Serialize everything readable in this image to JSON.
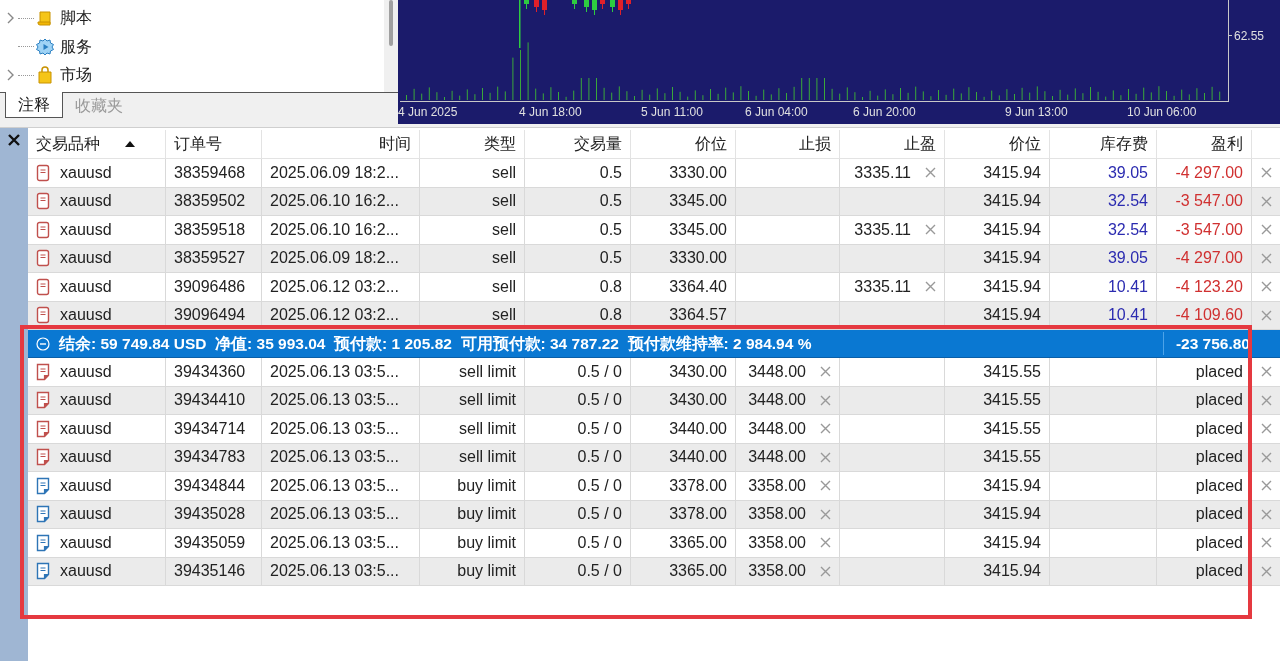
{
  "navigator": {
    "items": [
      {
        "label": "脚本",
        "kind": "script",
        "expandable": true
      },
      {
        "label": "服务",
        "kind": "service",
        "expandable": false
      },
      {
        "label": "市场",
        "kind": "market",
        "expandable": true
      }
    ]
  },
  "navigator_tabs": [
    {
      "label": "注释",
      "selected": true
    },
    {
      "label": "收藏夹",
      "selected": false
    }
  ],
  "chart": {
    "price_label": "62.55",
    "time_labels": [
      "4 Jun 2025",
      "4 Jun 18:00",
      "5 Jun 11:00",
      "6 Jun 04:00",
      "6 Jun 20:00",
      "9 Jun 13:00",
      "10 Jun 06:00"
    ]
  },
  "table": {
    "columns": [
      {
        "label": "交易品种",
        "sorted": true
      },
      {
        "label": "订单号",
        "sorted": false
      },
      {
        "label": "时间",
        "sorted": false
      },
      {
        "label": "类型",
        "sorted": false
      },
      {
        "label": "交易量",
        "sorted": false
      },
      {
        "label": "价位",
        "sorted": false
      },
      {
        "label": "止损",
        "sorted": false
      },
      {
        "label": "止盈",
        "sorted": false
      },
      {
        "label": "价位",
        "sorted": false
      },
      {
        "label": "库存费",
        "sorted": false
      },
      {
        "label": "盈利",
        "sorted": false
      }
    ],
    "positions": [
      {
        "kind": "position",
        "color": "#c0504d",
        "symbol": "xauusd",
        "order": "38359468",
        "time": "2025.06.09 18:2...",
        "type": "sell",
        "volume": "0.5",
        "price": "3330.00",
        "tp": "3335.11",
        "current": "3415.94",
        "swap": "39.05",
        "profit": "-4 297.00"
      },
      {
        "kind": "position",
        "color": "#c0504d",
        "symbol": "xauusd",
        "order": "38359502",
        "time": "2025.06.10 16:2...",
        "type": "sell",
        "volume": "0.5",
        "price": "3345.00",
        "current": "3415.94",
        "swap": "32.54",
        "profit": "-3 547.00"
      },
      {
        "kind": "position",
        "color": "#c0504d",
        "symbol": "xauusd",
        "order": "38359518",
        "time": "2025.06.10 16:2...",
        "type": "sell",
        "volume": "0.5",
        "price": "3345.00",
        "tp": "3335.11",
        "current": "3415.94",
        "swap": "32.54",
        "profit": "-3 547.00"
      },
      {
        "kind": "position",
        "color": "#c0504d",
        "symbol": "xauusd",
        "order": "38359527",
        "time": "2025.06.09 18:2...",
        "type": "sell",
        "volume": "0.5",
        "price": "3330.00",
        "current": "3415.94",
        "swap": "39.05",
        "profit": "-4 297.00"
      },
      {
        "kind": "position",
        "color": "#c0504d",
        "symbol": "xauusd",
        "order": "39096486",
        "time": "2025.06.12 03:2...",
        "type": "sell",
        "volume": "0.8",
        "price": "3364.40",
        "tp": "3335.11",
        "current": "3415.94",
        "swap": "10.41",
        "profit": "-4 123.20"
      },
      {
        "kind": "position",
        "color": "#c0504d",
        "symbol": "xauusd",
        "order": "39096494",
        "time": "2025.06.12 03:2...",
        "type": "sell",
        "volume": "0.8",
        "price": "3364.57",
        "current": "3415.94",
        "swap": "10.41",
        "profit": "-4 109.60"
      }
    ],
    "summary": {
      "expanded": true,
      "text": "结余: 59 749.84 USD  净值: 35 993.04  预付款: 1 205.82  可用预付款: 34 787.22  预付款维持率: 2 984.94 %",
      "total": "-23 756.80"
    },
    "orders": [
      {
        "kind": "pending",
        "color": "#c0504d",
        "symbol": "xauusd",
        "order": "39434360",
        "time": "2025.06.13 03:5...",
        "type": "sell limit",
        "volume": "0.5 / 0",
        "price": "3430.00",
        "sl": "3448.00",
        "current": "3415.55",
        "profit": "placed"
      },
      {
        "kind": "pending",
        "color": "#c0504d",
        "symbol": "xauusd",
        "order": "39434410",
        "time": "2025.06.13 03:5...",
        "type": "sell limit",
        "volume": "0.5 / 0",
        "price": "3430.00",
        "sl": "3448.00",
        "current": "3415.55",
        "profit": "placed"
      },
      {
        "kind": "pending",
        "color": "#c0504d",
        "symbol": "xauusd",
        "order": "39434714",
        "time": "2025.06.13 03:5...",
        "type": "sell limit",
        "volume": "0.5 / 0",
        "price": "3440.00",
        "sl": "3448.00",
        "current": "3415.55",
        "profit": "placed"
      },
      {
        "kind": "pending",
        "color": "#c0504d",
        "symbol": "xauusd",
        "order": "39434783",
        "time": "2025.06.13 03:5...",
        "type": "sell limit",
        "volume": "0.5 / 0",
        "price": "3440.00",
        "sl": "3448.00",
        "current": "3415.55",
        "profit": "placed"
      },
      {
        "kind": "pending",
        "color": "#2e75b6",
        "symbol": "xauusd",
        "order": "39434844",
        "time": "2025.06.13 03:5...",
        "type": "buy limit",
        "volume": "0.5 / 0",
        "price": "3378.00",
        "sl": "3358.00",
        "current": "3415.94",
        "profit": "placed"
      },
      {
        "kind": "pending",
        "color": "#2e75b6",
        "symbol": "xauusd",
        "order": "39435028",
        "time": "2025.06.13 03:5...",
        "type": "buy limit",
        "volume": "0.5 / 0",
        "price": "3378.00",
        "sl": "3358.00",
        "current": "3415.94",
        "profit": "placed"
      },
      {
        "kind": "pending",
        "color": "#2e75b6",
        "symbol": "xauusd",
        "order": "39435059",
        "time": "2025.06.13 03:5...",
        "type": "buy limit",
        "volume": "0.5 / 0",
        "price": "3365.00",
        "sl": "3358.00",
        "current": "3415.94",
        "profit": "placed"
      },
      {
        "kind": "pending",
        "color": "#2e75b6",
        "symbol": "xauusd",
        "order": "39435146",
        "time": "2025.06.13 03:5...",
        "type": "buy limit",
        "volume": "0.5 / 0",
        "price": "3365.00",
        "sl": "3358.00",
        "current": "3415.94",
        "profit": "placed"
      }
    ]
  },
  "highlight_frame": true
}
